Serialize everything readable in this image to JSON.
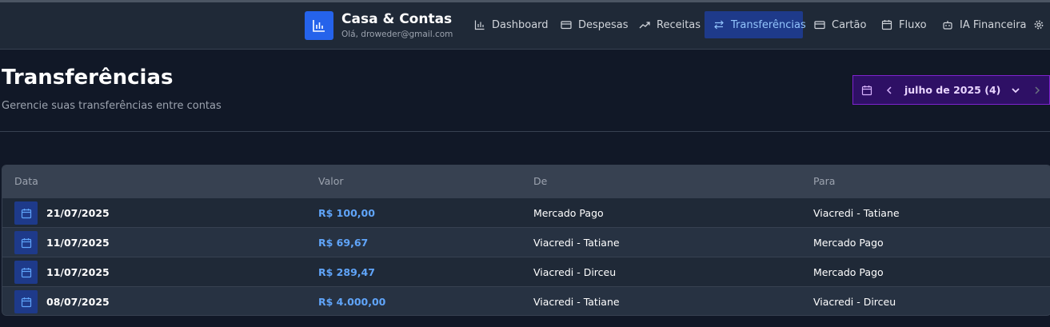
{
  "app": {
    "title": "Casa & Contas",
    "greeting": "Olá, droweder@gmail.com"
  },
  "nav": {
    "items": [
      {
        "label": "Dashboard",
        "icon": "bar-chart-icon"
      },
      {
        "label": "Despesas",
        "icon": "credit-card-icon"
      },
      {
        "label": "Receitas",
        "icon": "trending-up-icon"
      },
      {
        "label": "Transferências",
        "icon": "arrows-swap-icon",
        "active": true
      },
      {
        "label": "Cartão",
        "icon": "card-icon"
      },
      {
        "label": "Fluxo",
        "icon": "calendar-icon"
      },
      {
        "label": "IA Financeira",
        "icon": "bot-icon"
      },
      {
        "label": "",
        "icon": "gear-icon"
      }
    ]
  },
  "page": {
    "title": "Transferências",
    "subtitle": "Gerencie suas transferências entre contas"
  },
  "month_picker": {
    "label": "julho de 2025 (4)"
  },
  "table": {
    "headers": {
      "date": "Data",
      "value": "Valor",
      "from": "De",
      "to": "Para"
    },
    "rows": [
      {
        "date": "21/07/2025",
        "value": "R$ 100,00",
        "from": "Mercado Pago",
        "to": "Viacredi - Tatiane"
      },
      {
        "date": "11/07/2025",
        "value": "R$ 69,67",
        "from": "Viacredi - Tatiane",
        "to": "Mercado Pago"
      },
      {
        "date": "11/07/2025",
        "value": "R$ 289,47",
        "from": "Viacredi - Dirceu",
        "to": "Mercado Pago"
      },
      {
        "date": "08/07/2025",
        "value": "R$ 4.000,00",
        "from": "Viacredi - Tatiane",
        "to": "Viacredi - Dirceu"
      }
    ]
  },
  "colors": {
    "background": "#111827",
    "navbar": "#1f2937",
    "accent": "#2563eb",
    "active_nav_bg": "#1e3a8a",
    "value_text": "#60a5fa",
    "picker_border": "#7e22ce"
  }
}
